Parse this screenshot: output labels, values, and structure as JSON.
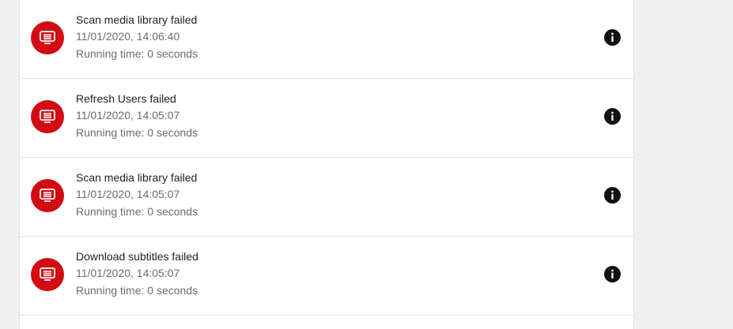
{
  "activity_log": {
    "entries": [
      {
        "title": "Scan media library failed",
        "date": "11/01/2020, 14:06:40",
        "running_time": "Running time: 0 seconds",
        "icon": "notes-icon",
        "info_icon": "info-icon"
      },
      {
        "title": "Refresh Users failed",
        "date": "11/01/2020, 14:05:07",
        "running_time": "Running time: 0 seconds",
        "icon": "notes-icon",
        "info_icon": "info-icon"
      },
      {
        "title": "Scan media library failed",
        "date": "11/01/2020, 14:05:07",
        "running_time": "Running time: 0 seconds",
        "icon": "notes-icon",
        "info_icon": "info-icon"
      },
      {
        "title": "Download subtitles failed",
        "date": "11/01/2020, 14:05:07",
        "running_time": "Running time: 0 seconds",
        "icon": "notes-icon",
        "info_icon": "info-icon"
      }
    ]
  },
  "colors": {
    "error_avatar": "#d20a11",
    "info_icon": "#111111",
    "divider": "#e0e0e0"
  }
}
